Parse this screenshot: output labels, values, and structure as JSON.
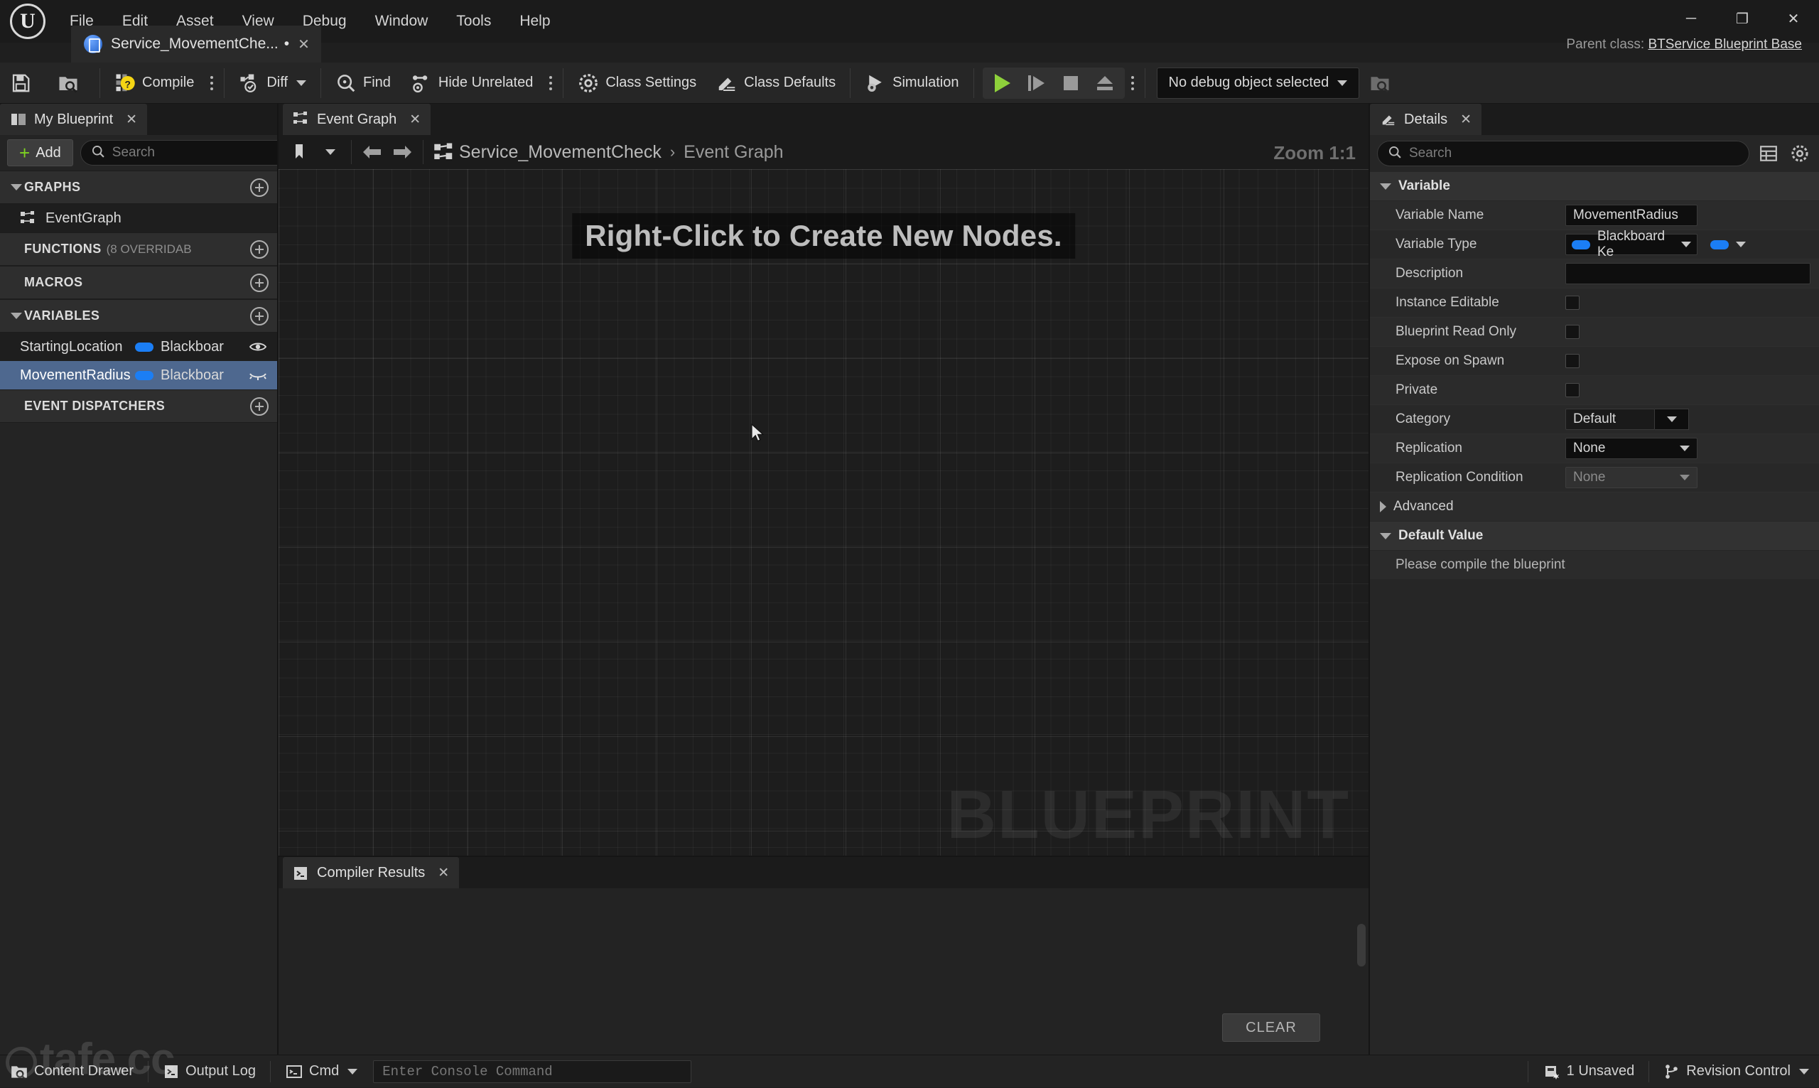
{
  "window": {
    "menus": [
      "File",
      "Edit",
      "Asset",
      "View",
      "Debug",
      "Window",
      "Tools",
      "Help"
    ],
    "minimize": "─",
    "maximize": "❐",
    "close": "✕",
    "parent_class_label": "Parent class:",
    "parent_class_value": "BTService Blueprint Base"
  },
  "asset_tab": {
    "label": "Service_MovementChe...",
    "dirty": "•",
    "close": "✕"
  },
  "toolbar": {
    "save_tip": "Save",
    "browse_tip": "Browse",
    "compile_label": "Compile",
    "diff_label": "Diff",
    "find_label": "Find",
    "hide_unrelated_label": "Hide Unrelated",
    "class_settings_label": "Class Settings",
    "class_defaults_label": "Class Defaults",
    "simulation_label": "Simulation",
    "debug_object": "No debug object selected"
  },
  "my_blueprint": {
    "tab_label": "My Blueprint",
    "tab_close": "✕",
    "add_label": "Add",
    "search_placeholder": "Search",
    "search_value": "",
    "sections": [
      {
        "title": "GRAPHS",
        "sub": "",
        "expanded": true
      },
      {
        "title": "FUNCTIONS",
        "sub": "(8 OVERRIDAB",
        "expanded": false
      },
      {
        "title": "MACROS",
        "sub": "",
        "expanded": false
      },
      {
        "title": "VARIABLES",
        "sub": "",
        "expanded": true
      },
      {
        "title": "EVENT DISPATCHERS",
        "sub": "",
        "expanded": false
      }
    ],
    "graphs": [
      {
        "name": "EventGraph"
      }
    ],
    "variables": [
      {
        "name": "StartingLocation",
        "type": "Blackboar",
        "selected": false,
        "visibility": "visible"
      },
      {
        "name": "MovementRadius",
        "type": "Blackboar",
        "selected": true,
        "visibility": "hidden"
      }
    ]
  },
  "graph": {
    "tab_label": "Event Graph",
    "tab_close": "✕",
    "breadcrumb_root": "Service_MovementCheck",
    "breadcrumb_sep": "›",
    "breadcrumb_current": "Event Graph",
    "zoom_label": "Zoom 1:1",
    "hint": "Right-Click to Create New Nodes.",
    "watermark": "BLUEPRINT"
  },
  "compiler_results": {
    "tab_label": "Compiler Results",
    "tab_close": "✕",
    "clear_label": "CLEAR",
    "messages": []
  },
  "details": {
    "tab_label": "Details",
    "tab_close": "✕",
    "search_placeholder": "Search",
    "search_value": "",
    "variable_section": "Variable",
    "rows": [
      {
        "label": "Variable Name",
        "kind": "text",
        "value": "MovementRadius"
      },
      {
        "label": "Variable Type",
        "kind": "type",
        "value": "Blackboard Ke"
      },
      {
        "label": "Description",
        "kind": "text",
        "value": ""
      },
      {
        "label": "Instance Editable",
        "kind": "check",
        "value": false
      },
      {
        "label": "Blueprint Read Only",
        "kind": "check",
        "value": false
      },
      {
        "label": "Expose on Spawn",
        "kind": "check",
        "value": false
      },
      {
        "label": "Private",
        "kind": "check",
        "value": false
      },
      {
        "label": "Category",
        "kind": "category",
        "value": "Default"
      },
      {
        "label": "Replication",
        "kind": "combo",
        "value": "None"
      },
      {
        "label": "Replication Condition",
        "kind": "combo-disabled",
        "value": "None"
      }
    ],
    "advanced_label": "Advanced",
    "default_value_label": "Default Value",
    "default_value_text": "Please compile the blueprint"
  },
  "status_bar": {
    "content_drawer": "Content Drawer",
    "output_log": "Output Log",
    "cmd_label": "Cmd",
    "console_placeholder": "Enter Console Command",
    "console_value": "",
    "unsaved": "1 Unsaved",
    "revision_control": "Revision Control"
  },
  "overlay_watermark": "tafe.cc",
  "colors": {
    "accent_blue": "#1b7ef5",
    "selection": "#4e688f",
    "play_green": "#8ed13b",
    "add_green": "#7ed321"
  }
}
